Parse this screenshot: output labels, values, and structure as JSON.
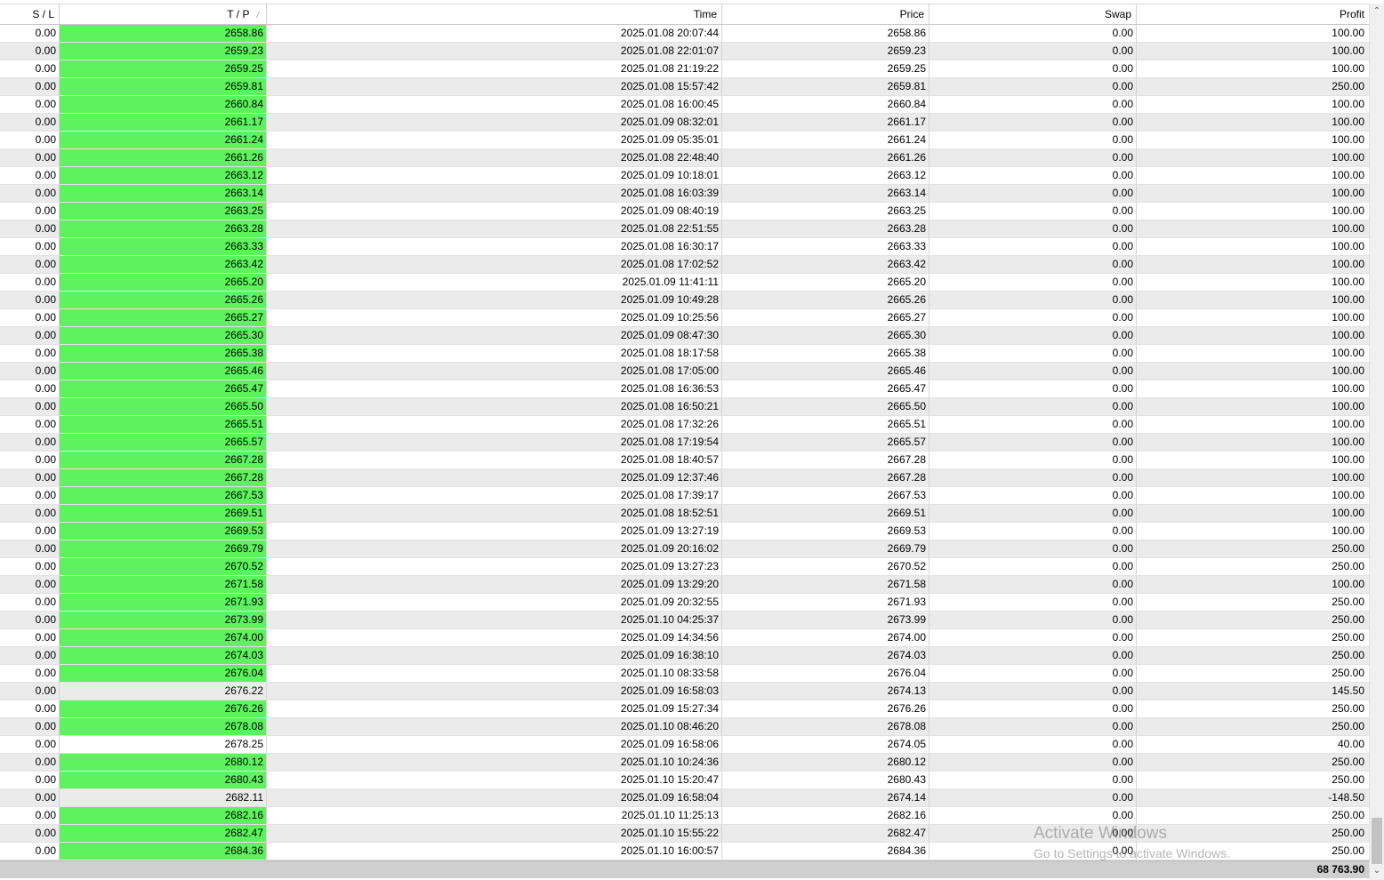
{
  "columns": {
    "sl": "S / L",
    "tp": "T / P",
    "time": "Time",
    "price": "Price",
    "swap": "Swap",
    "profit": "Profit"
  },
  "sort_indicator": "⁄",
  "colors": {
    "tp_highlight": "#5ef25e",
    "row_even": "#ebebeb",
    "row_odd": "#ffffff",
    "total_bar": "#cfcfcf"
  },
  "rows": [
    {
      "sl": "0.00",
      "tp": "2658.86",
      "tp_hit": true,
      "time": "2025.01.08 20:07:44",
      "price": "2658.86",
      "swap": "0.00",
      "profit": "100.00"
    },
    {
      "sl": "0.00",
      "tp": "2659.23",
      "tp_hit": true,
      "time": "2025.01.08 22:01:07",
      "price": "2659.23",
      "swap": "0.00",
      "profit": "100.00"
    },
    {
      "sl": "0.00",
      "tp": "2659.25",
      "tp_hit": true,
      "time": "2025.01.08 21:19:22",
      "price": "2659.25",
      "swap": "0.00",
      "profit": "100.00"
    },
    {
      "sl": "0.00",
      "tp": "2659.81",
      "tp_hit": true,
      "time": "2025.01.08 15:57:42",
      "price": "2659.81",
      "swap": "0.00",
      "profit": "250.00"
    },
    {
      "sl": "0.00",
      "tp": "2660.84",
      "tp_hit": true,
      "time": "2025.01.08 16:00:45",
      "price": "2660.84",
      "swap": "0.00",
      "profit": "100.00"
    },
    {
      "sl": "0.00",
      "tp": "2661.17",
      "tp_hit": true,
      "time": "2025.01.09 08:32:01",
      "price": "2661.17",
      "swap": "0.00",
      "profit": "100.00"
    },
    {
      "sl": "0.00",
      "tp": "2661.24",
      "tp_hit": true,
      "time": "2025.01.09 05:35:01",
      "price": "2661.24",
      "swap": "0.00",
      "profit": "100.00"
    },
    {
      "sl": "0.00",
      "tp": "2661.26",
      "tp_hit": true,
      "time": "2025.01.08 22:48:40",
      "price": "2661.26",
      "swap": "0.00",
      "profit": "100.00"
    },
    {
      "sl": "0.00",
      "tp": "2663.12",
      "tp_hit": true,
      "time": "2025.01.09 10:18:01",
      "price": "2663.12",
      "swap": "0.00",
      "profit": "100.00"
    },
    {
      "sl": "0.00",
      "tp": "2663.14",
      "tp_hit": true,
      "time": "2025.01.08 16:03:39",
      "price": "2663.14",
      "swap": "0.00",
      "profit": "100.00"
    },
    {
      "sl": "0.00",
      "tp": "2663.25",
      "tp_hit": true,
      "time": "2025.01.09 08:40:19",
      "price": "2663.25",
      "swap": "0.00",
      "profit": "100.00"
    },
    {
      "sl": "0.00",
      "tp": "2663.28",
      "tp_hit": true,
      "time": "2025.01.08 22:51:55",
      "price": "2663.28",
      "swap": "0.00",
      "profit": "100.00"
    },
    {
      "sl": "0.00",
      "tp": "2663.33",
      "tp_hit": true,
      "time": "2025.01.08 16:30:17",
      "price": "2663.33",
      "swap": "0.00",
      "profit": "100.00"
    },
    {
      "sl": "0.00",
      "tp": "2663.42",
      "tp_hit": true,
      "time": "2025.01.08 17:02:52",
      "price": "2663.42",
      "swap": "0.00",
      "profit": "100.00"
    },
    {
      "sl": "0.00",
      "tp": "2665.20",
      "tp_hit": true,
      "time": "2025.01.09 11:41:11",
      "price": "2665.20",
      "swap": "0.00",
      "profit": "100.00"
    },
    {
      "sl": "0.00",
      "tp": "2665.26",
      "tp_hit": true,
      "time": "2025.01.09 10:49:28",
      "price": "2665.26",
      "swap": "0.00",
      "profit": "100.00"
    },
    {
      "sl": "0.00",
      "tp": "2665.27",
      "tp_hit": true,
      "time": "2025.01.09 10:25:56",
      "price": "2665.27",
      "swap": "0.00",
      "profit": "100.00"
    },
    {
      "sl": "0.00",
      "tp": "2665.30",
      "tp_hit": true,
      "time": "2025.01.09 08:47:30",
      "price": "2665.30",
      "swap": "0.00",
      "profit": "100.00"
    },
    {
      "sl": "0.00",
      "tp": "2665.38",
      "tp_hit": true,
      "time": "2025.01.08 18:17:58",
      "price": "2665.38",
      "swap": "0.00",
      "profit": "100.00"
    },
    {
      "sl": "0.00",
      "tp": "2665.46",
      "tp_hit": true,
      "time": "2025.01.08 17:05:00",
      "price": "2665.46",
      "swap": "0.00",
      "profit": "100.00"
    },
    {
      "sl": "0.00",
      "tp": "2665.47",
      "tp_hit": true,
      "time": "2025.01.08 16:36:53",
      "price": "2665.47",
      "swap": "0.00",
      "profit": "100.00"
    },
    {
      "sl": "0.00",
      "tp": "2665.50",
      "tp_hit": true,
      "time": "2025.01.08 16:50:21",
      "price": "2665.50",
      "swap": "0.00",
      "profit": "100.00"
    },
    {
      "sl": "0.00",
      "tp": "2665.51",
      "tp_hit": true,
      "time": "2025.01.08 17:32:26",
      "price": "2665.51",
      "swap": "0.00",
      "profit": "100.00"
    },
    {
      "sl": "0.00",
      "tp": "2665.57",
      "tp_hit": true,
      "time": "2025.01.08 17:19:54",
      "price": "2665.57",
      "swap": "0.00",
      "profit": "100.00"
    },
    {
      "sl": "0.00",
      "tp": "2667.28",
      "tp_hit": true,
      "time": "2025.01.08 18:40:57",
      "price": "2667.28",
      "swap": "0.00",
      "profit": "100.00"
    },
    {
      "sl": "0.00",
      "tp": "2667.28",
      "tp_hit": true,
      "time": "2025.01.09 12:37:46",
      "price": "2667.28",
      "swap": "0.00",
      "profit": "100.00"
    },
    {
      "sl": "0.00",
      "tp": "2667.53",
      "tp_hit": true,
      "time": "2025.01.08 17:39:17",
      "price": "2667.53",
      "swap": "0.00",
      "profit": "100.00"
    },
    {
      "sl": "0.00",
      "tp": "2669.51",
      "tp_hit": true,
      "time": "2025.01.08 18:52:51",
      "price": "2669.51",
      "swap": "0.00",
      "profit": "100.00"
    },
    {
      "sl": "0.00",
      "tp": "2669.53",
      "tp_hit": true,
      "time": "2025.01.09 13:27:19",
      "price": "2669.53",
      "swap": "0.00",
      "profit": "100.00"
    },
    {
      "sl": "0.00",
      "tp": "2669.79",
      "tp_hit": true,
      "time": "2025.01.09 20:16:02",
      "price": "2669.79",
      "swap": "0.00",
      "profit": "250.00"
    },
    {
      "sl": "0.00",
      "tp": "2670.52",
      "tp_hit": true,
      "time": "2025.01.09 13:27:23",
      "price": "2670.52",
      "swap": "0.00",
      "profit": "250.00"
    },
    {
      "sl": "0.00",
      "tp": "2671.58",
      "tp_hit": true,
      "time": "2025.01.09 13:29:20",
      "price": "2671.58",
      "swap": "0.00",
      "profit": "100.00"
    },
    {
      "sl": "0.00",
      "tp": "2671.93",
      "tp_hit": true,
      "time": "2025.01.09 20:32:55",
      "price": "2671.93",
      "swap": "0.00",
      "profit": "250.00"
    },
    {
      "sl": "0.00",
      "tp": "2673.99",
      "tp_hit": true,
      "time": "2025.01.10 04:25:37",
      "price": "2673.99",
      "swap": "0.00",
      "profit": "250.00"
    },
    {
      "sl": "0.00",
      "tp": "2674.00",
      "tp_hit": true,
      "time": "2025.01.09 14:34:56",
      "price": "2674.00",
      "swap": "0.00",
      "profit": "250.00"
    },
    {
      "sl": "0.00",
      "tp": "2674.03",
      "tp_hit": true,
      "time": "2025.01.09 16:38:10",
      "price": "2674.03",
      "swap": "0.00",
      "profit": "250.00"
    },
    {
      "sl": "0.00",
      "tp": "2676.04",
      "tp_hit": true,
      "time": "2025.01.10 08:33:58",
      "price": "2676.04",
      "swap": "0.00",
      "profit": "250.00"
    },
    {
      "sl": "0.00",
      "tp": "2676.22",
      "tp_hit": false,
      "time": "2025.01.09 16:58:03",
      "price": "2674.13",
      "swap": "0.00",
      "profit": "145.50"
    },
    {
      "sl": "0.00",
      "tp": "2676.26",
      "tp_hit": true,
      "time": "2025.01.09 15:27:34",
      "price": "2676.26",
      "swap": "0.00",
      "profit": "250.00"
    },
    {
      "sl": "0.00",
      "tp": "2678.08",
      "tp_hit": true,
      "time": "2025.01.10 08:46:20",
      "price": "2678.08",
      "swap": "0.00",
      "profit": "250.00"
    },
    {
      "sl": "0.00",
      "tp": "2678.25",
      "tp_hit": false,
      "time": "2025.01.09 16:58:06",
      "price": "2674.05",
      "swap": "0.00",
      "profit": "40.00"
    },
    {
      "sl": "0.00",
      "tp": "2680.12",
      "tp_hit": true,
      "time": "2025.01.10 10:24:36",
      "price": "2680.12",
      "swap": "0.00",
      "profit": "250.00"
    },
    {
      "sl": "0.00",
      "tp": "2680.43",
      "tp_hit": true,
      "time": "2025.01.10 15:20:47",
      "price": "2680.43",
      "swap": "0.00",
      "profit": "250.00"
    },
    {
      "sl": "0.00",
      "tp": "2682.11",
      "tp_hit": false,
      "time": "2025.01.09 16:58:04",
      "price": "2674.14",
      "swap": "0.00",
      "profit": "-148.50"
    },
    {
      "sl": "0.00",
      "tp": "2682.16",
      "tp_hit": true,
      "time": "2025.01.10 11:25:13",
      "price": "2682.16",
      "swap": "0.00",
      "profit": "250.00"
    },
    {
      "sl": "0.00",
      "tp": "2682.47",
      "tp_hit": true,
      "time": "2025.01.10 15:55:22",
      "price": "2682.47",
      "swap": "0.00",
      "profit": "250.00"
    },
    {
      "sl": "0.00",
      "tp": "2684.36",
      "tp_hit": true,
      "time": "2025.01.10 16:00:57",
      "price": "2684.36",
      "swap": "0.00",
      "profit": "250.00"
    }
  ],
  "total_profit": "68 763.90",
  "scrollbar": {
    "up_glyph": "⌃",
    "down_glyph": "⌄"
  },
  "watermark": {
    "title": "Activate Windows",
    "subtitle": "Go to Settings to activate Windows."
  }
}
